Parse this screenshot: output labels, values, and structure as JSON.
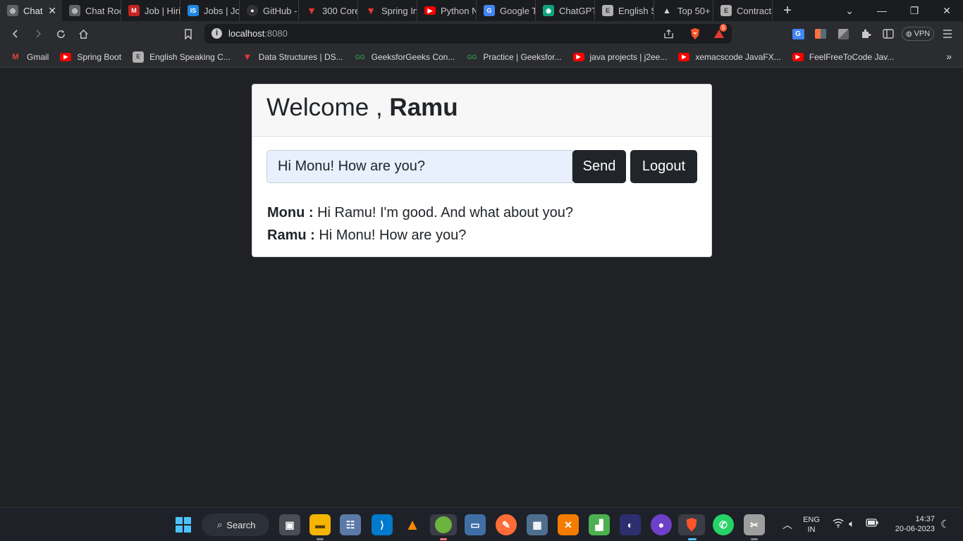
{
  "browser": {
    "tabs": [
      {
        "title": "Chat",
        "color": "#5f6368",
        "glyph": "◎"
      },
      {
        "title": "Chat Roo",
        "color": "#5f6368",
        "glyph": "◎"
      },
      {
        "title": "Job | Hiri",
        "color": "#c5221f",
        "glyph": "M"
      },
      {
        "title": "Jobs | Jol",
        "color": "#1e88e5",
        "glyph": "IS"
      },
      {
        "title": "GitHub -",
        "color": "#333333",
        "glyph": "●"
      },
      {
        "title": "300 Core",
        "color": "#e53935",
        "glyph": "▼"
      },
      {
        "title": "Spring In",
        "color": "#e53935",
        "glyph": "▼"
      },
      {
        "title": "Python N",
        "color": "#ff0000",
        "glyph": "▶"
      },
      {
        "title": "Google T",
        "color": "#4285f4",
        "glyph": "G"
      },
      {
        "title": "ChatGPT",
        "color": "#10a37f",
        "glyph": "◉"
      },
      {
        "title": "English S",
        "color": "#b0b0b0",
        "glyph": "E"
      },
      {
        "title": "Top 50+",
        "color": "#607d8b",
        "glyph": "▲"
      },
      {
        "title": "Contract",
        "color": "#b0b0b0",
        "glyph": "E"
      }
    ],
    "url_host": "localhost",
    "url_port": ":8080",
    "vpn_label": "VPN",
    "brave_badge": "5",
    "bookmarks": [
      {
        "label": "Gmail",
        "color": "#c5221f",
        "glyph": "M"
      },
      {
        "label": "Spring Boot",
        "color": "#ff0000",
        "glyph": "▶"
      },
      {
        "label": "English Speaking C...",
        "color": "#b0b0b0",
        "glyph": "E"
      },
      {
        "label": "Data Structures | DS...",
        "color": "#e53935",
        "glyph": "▼"
      },
      {
        "label": "GeeksforGeeks Con...",
        "color": "#2f8d46",
        "glyph": "GG"
      },
      {
        "label": "Practice | Geeksfor...",
        "color": "#2f8d46",
        "glyph": "GG"
      },
      {
        "label": "java projects | j2ee...",
        "color": "#ff0000",
        "glyph": "▶"
      },
      {
        "label": "xemacscode JavaFX...",
        "color": "#ff0000",
        "glyph": "▶"
      },
      {
        "label": "FeelFreeToCode Jav...",
        "color": "#ff0000",
        "glyph": "▶"
      }
    ]
  },
  "page": {
    "welcome_prefix": "Welcome ,",
    "username": "Ramu",
    "input_value": "Hi Monu! How are you?",
    "send_label": "Send",
    "logout_label": "Logout",
    "messages": [
      {
        "sender": "Monu :",
        "text": "Hi Ramu! I'm good. And what about you?"
      },
      {
        "sender": "Ramu :",
        "text": "Hi Monu! How are you?"
      }
    ]
  },
  "taskbar": {
    "search_label": "Search",
    "language_line1": "ENG",
    "language_line2": "IN",
    "time": "14:37",
    "date": "20-06-2023"
  }
}
